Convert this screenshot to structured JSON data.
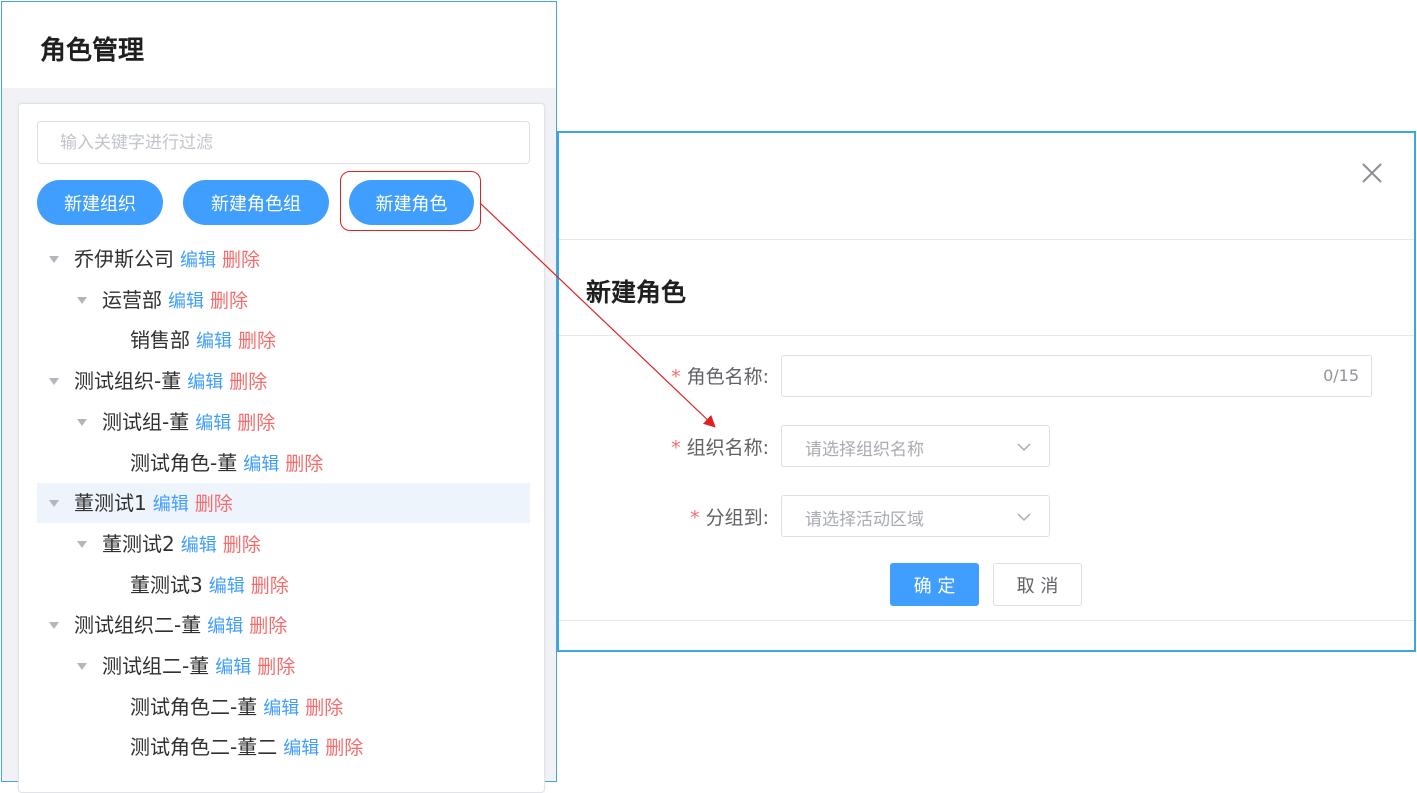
{
  "left_panel": {
    "title": "角色管理",
    "filter_placeholder": "输入关键字进行过滤",
    "buttons": {
      "new_org": "新建组织",
      "new_role_group": "新建角色组",
      "new_role": "新建角色"
    },
    "edit_label": "编辑",
    "delete_label": "删除",
    "tree": [
      {
        "label": "乔伊斯公司",
        "level": 0,
        "expanded": true,
        "selected": false
      },
      {
        "label": "运营部",
        "level": 1,
        "expanded": true,
        "selected": false
      },
      {
        "label": "销售部",
        "level": 2,
        "expanded": null,
        "selected": false
      },
      {
        "label": "测试组织-董",
        "level": 0,
        "expanded": true,
        "selected": false
      },
      {
        "label": "测试组-董",
        "level": 1,
        "expanded": true,
        "selected": false
      },
      {
        "label": "测试角色-董",
        "level": 2,
        "expanded": null,
        "selected": false
      },
      {
        "label": "董测试1",
        "level": 0,
        "expanded": true,
        "selected": true
      },
      {
        "label": "董测试2",
        "level": 1,
        "expanded": true,
        "selected": false
      },
      {
        "label": "董测试3",
        "level": 2,
        "expanded": null,
        "selected": false
      },
      {
        "label": "测试组织二-董",
        "level": 0,
        "expanded": true,
        "selected": false
      },
      {
        "label": "测试组二-董",
        "level": 1,
        "expanded": true,
        "selected": false
      },
      {
        "label": "测试角色二-董",
        "level": 2,
        "expanded": null,
        "selected": false
      },
      {
        "label": "测试角色二-董二",
        "level": 2,
        "expanded": null,
        "selected": false
      }
    ]
  },
  "dialog": {
    "title": "新建角色",
    "fields": {
      "role_name": {
        "label": "角色名称:",
        "value": "",
        "counter": "0/15"
      },
      "org_name": {
        "label": "组织名称:",
        "placeholder": "请选择组织名称"
      },
      "group_to": {
        "label": "分组到:",
        "placeholder": "请选择活动区域"
      }
    },
    "buttons": {
      "confirm": "确 定",
      "cancel": "取 消"
    }
  },
  "colors": {
    "primary": "#409eff",
    "danger": "#f56c6c",
    "annotation_red": "#e02020",
    "border_blue": "#3ba7df"
  }
}
